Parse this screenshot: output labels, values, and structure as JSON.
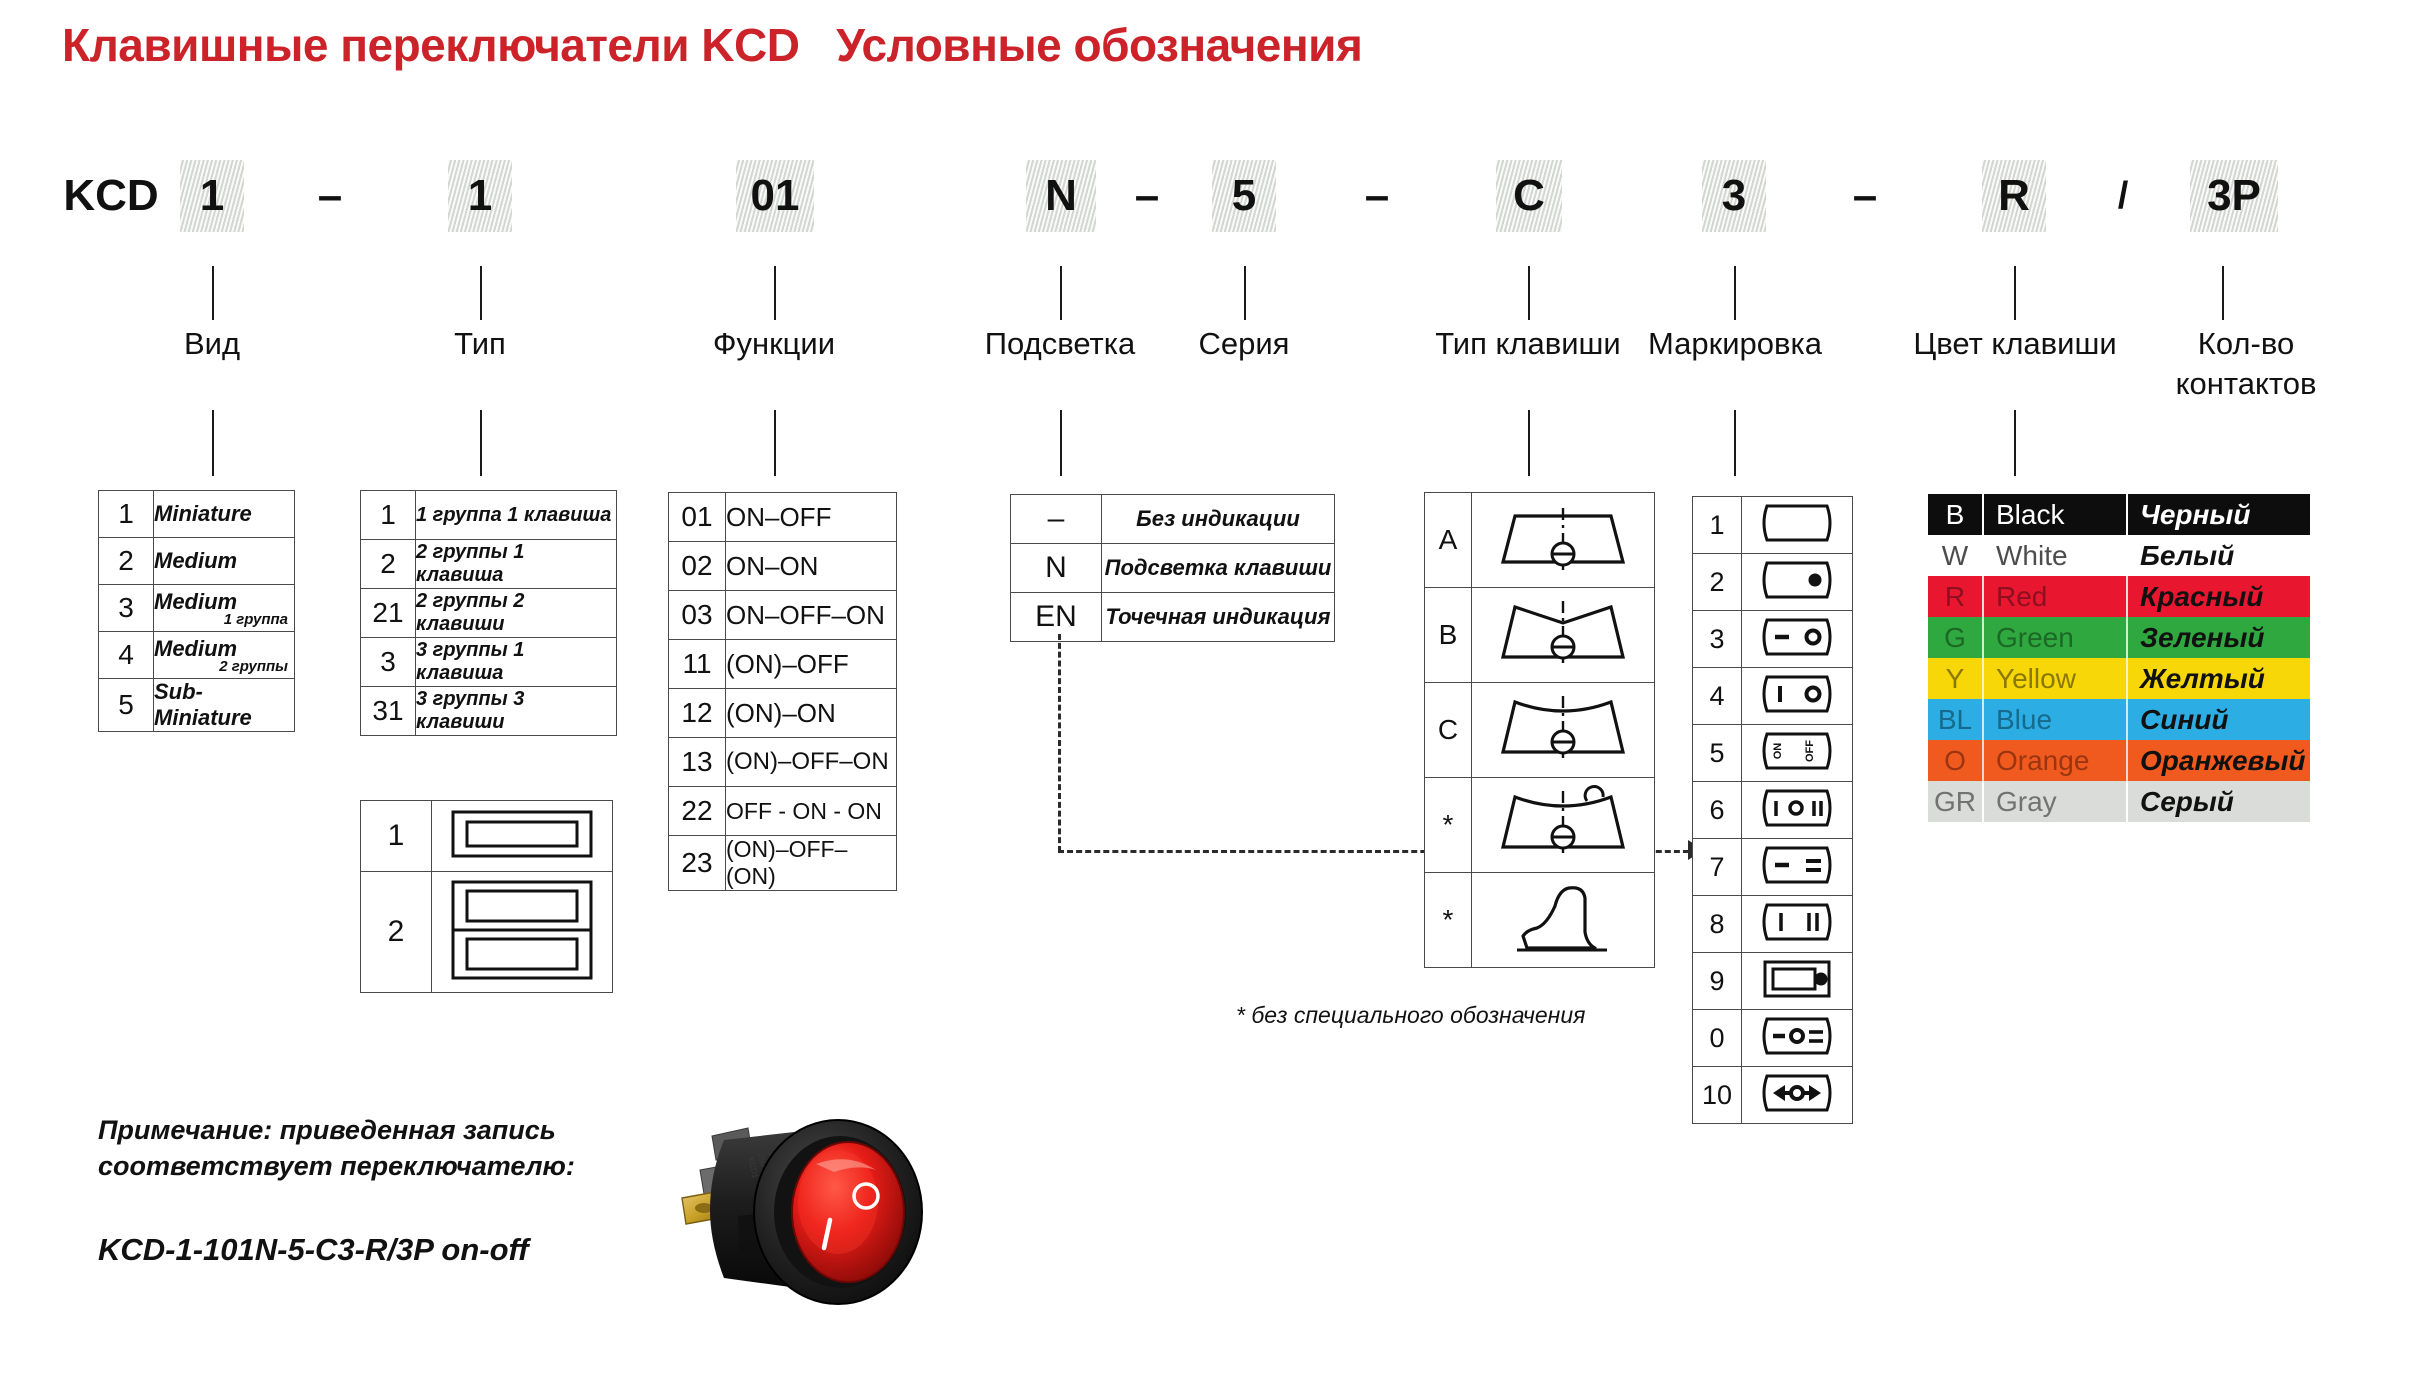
{
  "title": "Клавишные переключатели KCD   Условные обозначения",
  "code_row": {
    "prefix": "KCD",
    "segments": [
      {
        "kind": "box",
        "text": "1"
      },
      {
        "kind": "sep",
        "text": "–"
      },
      {
        "kind": "box",
        "text": "1"
      },
      {
        "kind": "box",
        "text": "01"
      },
      {
        "kind": "box",
        "text": "N"
      },
      {
        "kind": "sep",
        "text": "–"
      },
      {
        "kind": "box",
        "text": "5"
      },
      {
        "kind": "sep",
        "text": "–"
      },
      {
        "kind": "box",
        "text": "C"
      },
      {
        "kind": "box",
        "text": "3"
      },
      {
        "kind": "sep",
        "text": "–"
      },
      {
        "kind": "box",
        "text": "R"
      },
      {
        "kind": "sep",
        "text": "/"
      },
      {
        "kind": "box",
        "text": "3P"
      }
    ]
  },
  "categories": [
    {
      "label": "Вид"
    },
    {
      "label": "Тип"
    },
    {
      "label": "Функции"
    },
    {
      "label": "Подсветка"
    },
    {
      "label": "Серия"
    },
    {
      "label": "Тип клавиши"
    },
    {
      "label": "Маркировка"
    },
    {
      "label": "Цвет клавиши"
    },
    {
      "label": "Кол-во",
      "label2": "контактов"
    }
  ],
  "vid_table": {
    "rows": [
      {
        "code": "1",
        "desc": "Miniature",
        "sub": ""
      },
      {
        "code": "2",
        "desc": "Medium",
        "sub": ""
      },
      {
        "code": "3",
        "desc": "Medium",
        "sub": "1 группа"
      },
      {
        "code": "4",
        "desc": "Medium",
        "sub": "2 группы"
      },
      {
        "code": "5",
        "desc": "Sub-Miniature",
        "sub": ""
      }
    ]
  },
  "tip_table": {
    "rows": [
      {
        "code": "1",
        "desc": "1 группа 1 клавиша"
      },
      {
        "code": "2",
        "desc": "2 группы 1 клавиша"
      },
      {
        "code": "21",
        "desc": "2 группы 2 клавиши"
      },
      {
        "code": "3",
        "desc": "3 группы 1 клавиша"
      },
      {
        "code": "31",
        "desc": "3 группы 3 клавиши"
      }
    ]
  },
  "tip_symbol_table": {
    "rows": [
      {
        "code": "1",
        "symbol": "single-rocker-frame-icon"
      },
      {
        "code": "2",
        "symbol": "double-rocker-frame-icon"
      }
    ]
  },
  "function_table": {
    "rows": [
      {
        "code": "01",
        "desc": "ON–OFF"
      },
      {
        "code": "02",
        "desc": "ON–ON"
      },
      {
        "code": "03",
        "desc": "ON–OFF–ON"
      },
      {
        "code": "11",
        "desc": "(ON)–OFF"
      },
      {
        "code": "12",
        "desc": "(ON)–ON"
      },
      {
        "code": "13",
        "desc": "(ON)–OFF–ON"
      },
      {
        "code": "22",
        "desc": "OFF - ON - ON"
      },
      {
        "code": "23",
        "desc": "(ON)–OFF–(ON)"
      }
    ]
  },
  "backlight_table": {
    "rows": [
      {
        "code": "–",
        "desc": "Без индикации"
      },
      {
        "code": "N",
        "desc": "Подсветка клавиши"
      },
      {
        "code": "EN",
        "desc": "Точечная индикация"
      }
    ]
  },
  "keytype_table": {
    "rows": [
      {
        "code": "A",
        "symbol": "flat-rocker-profile-icon"
      },
      {
        "code": "B",
        "symbol": "v-notch-rocker-profile-icon"
      },
      {
        "code": "C",
        "symbol": "concave-rocker-profile-icon"
      },
      {
        "code": "*",
        "symbol": "concave-rocker-with-lamp-profile-icon"
      },
      {
        "code": "*",
        "symbol": "paddle-lever-profile-icon"
      }
    ]
  },
  "marking_table": {
    "rows": [
      {
        "code": "1",
        "symbol": "blank-rocker-icon"
      },
      {
        "code": "2",
        "symbol": "rocker-with-dot-icon"
      },
      {
        "code": "3",
        "symbol": "dash-circle-rocker-icon"
      },
      {
        "code": "4",
        "symbol": "bar-circle-rocker-icon"
      },
      {
        "code": "5",
        "symbol": "on-off-text-rocker-icon"
      },
      {
        "code": "6",
        "symbol": "bar-circle-doublebar-rocker-icon"
      },
      {
        "code": "7",
        "symbol": "dash-doubledash-rocker-icon"
      },
      {
        "code": "8",
        "symbol": "bar-doublebar-rocker-icon"
      },
      {
        "code": "9",
        "symbol": "rect-window-with-dot-icon"
      },
      {
        "code": "0",
        "symbol": "dash-circle-doubledash-rocker-icon"
      },
      {
        "code": "10",
        "symbol": "arrows-circle-rocker-icon"
      }
    ]
  },
  "color_table": {
    "rows": [
      {
        "code": "B",
        "en": "Black",
        "ru": "Черный",
        "bg": "#0d0d0d",
        "fg": "#ffffff"
      },
      {
        "code": "W",
        "en": "White",
        "ru": "Белый",
        "bg": "#ffffff",
        "fg": "#4d4d4d"
      },
      {
        "code": "R",
        "en": "Red",
        "ru": "Красный",
        "bg": "#E8162E",
        "fg": "#8c1020"
      },
      {
        "code": "G",
        "en": "Green",
        "ru": "Зеленый",
        "bg": "#2FA83F",
        "fg": "#1d6827"
      },
      {
        "code": "Y",
        "en": "Yellow",
        "ru": "Желтый",
        "bg": "#F7D707",
        "fg": "#8a7804"
      },
      {
        "code": "BL",
        "en": "Blue",
        "ru": "Синий",
        "bg": "#2CAEE4",
        "fg": "#176a8c"
      },
      {
        "code": "O",
        "en": "Orange",
        "ru": "Оранжевый",
        "bg": "#F05A1E",
        "fg": "#9a3512"
      },
      {
        "code": "GR",
        "en": "Gray",
        "ru": "Серый",
        "bg": "#D9DCD9",
        "fg": "#70736f"
      }
    ]
  },
  "footnote": "*  без  специального обозначения",
  "note": {
    "line1": "Примечание:   приведенная запись",
    "line2": "соответствует переключателю:",
    "code": "KCD-1-101N-5-C3-R/3P on-off"
  },
  "photo": {
    "name": "round-rocker-switch-photo",
    "body_color": "#1a1a1a",
    "rocker_color": "#E02020",
    "terminal_color": "#C9A227"
  }
}
